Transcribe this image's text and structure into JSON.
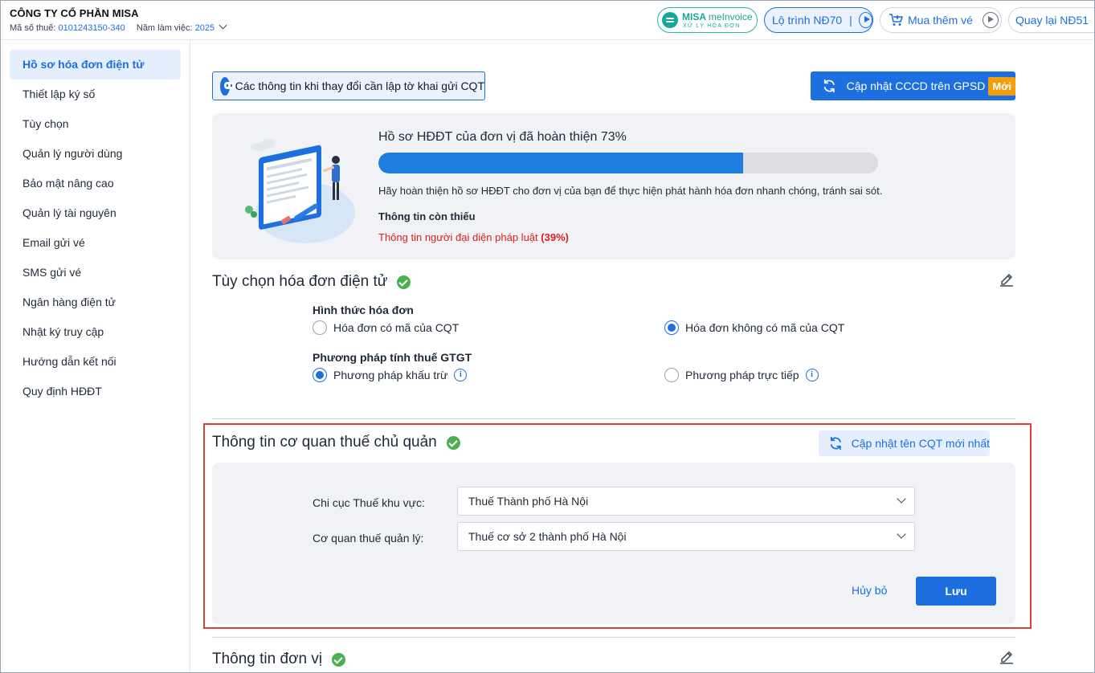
{
  "header": {
    "company": "CÔNG TY CỔ PHẦN MISA",
    "tax_label": "Mã số thuế:",
    "tax_value": "0101243150-340",
    "year_label": "Năm làm việc:",
    "year_value": "2025",
    "logo_brand": "MISA",
    "logo_brand2": "meInvoice",
    "logo_tagline": "XỬ LÝ HÓA ĐƠN",
    "roadmap_label": "Lộ trình NĐ70",
    "buy_label": "Mua thêm vé",
    "back_label": "Quay lại NĐ51"
  },
  "sidebar": {
    "items": [
      {
        "label": "Hồ sơ hóa đơn điện tử",
        "active": true
      },
      {
        "label": "Thiết lập ký số"
      },
      {
        "label": "Tùy chọn"
      },
      {
        "label": "Quản lý người dùng"
      },
      {
        "label": "Bảo mật nâng cao"
      },
      {
        "label": "Quản lý tài nguyên"
      },
      {
        "label": "Email gửi vé"
      },
      {
        "label": "SMS gửi vé"
      },
      {
        "label": "Ngân hàng điện tử"
      },
      {
        "label": "Nhật ký truy cập"
      },
      {
        "label": "Hướng dẫn kết nối"
      },
      {
        "label": "Quy định HĐĐT"
      }
    ]
  },
  "main": {
    "notice_label": "Các thông tin khi thay đổi cần lập tờ khai gửi CQT",
    "update_cccd_label": "Cập nhật CCCD trên GPSD",
    "update_cccd_badge": "Mới",
    "progress": {
      "title": "Hồ sơ HĐĐT của đơn vị đã hoàn thiện 73%",
      "percent": 73,
      "description": "Hãy hoàn thiện hồ sơ HĐĐT cho đơn vị của bạn để thực hiện phát hành hóa đơn nhanh chóng, tránh sai sót.",
      "missing_title": "Thông tin còn thiếu",
      "missing_item": "Thông tin người đại diện pháp luật",
      "missing_item_pct": "(39%)"
    },
    "invoice_options": {
      "title": "Tùy chọn hóa đơn điện tử",
      "form_label": "Hình thức hóa đơn",
      "form_opt1": "Hóa đơn có mã của CQT",
      "form_opt2": "Hóa đơn không có mã của CQT",
      "vat_label": "Phương pháp tính thuế GTGT",
      "vat_opt1": "Phương pháp khấu trừ",
      "vat_opt2": "Phương pháp trực tiếp"
    },
    "tax_authority": {
      "title": "Thông tin cơ quan thuế chủ quản",
      "update_label": "Cập nhật tên CQT mới nhất",
      "branch_label": "Chi cục Thuế khu vực:",
      "branch_value": "Thuế Thành phố Hà Nội",
      "office_label": "Cơ quan thuế quản lý:",
      "office_value": "Thuế cơ sở 2 thành phố Hà Nội",
      "cancel_label": "Hủy bỏ",
      "save_label": "Lưu"
    },
    "unit_info": {
      "title": "Thông tin đơn vị"
    }
  },
  "colors": {
    "primary": "#1d6fe0",
    "success": "#4caf50",
    "danger": "#e11d1d",
    "badge": "#f59e0b",
    "highlight_border": "#d9413a"
  }
}
